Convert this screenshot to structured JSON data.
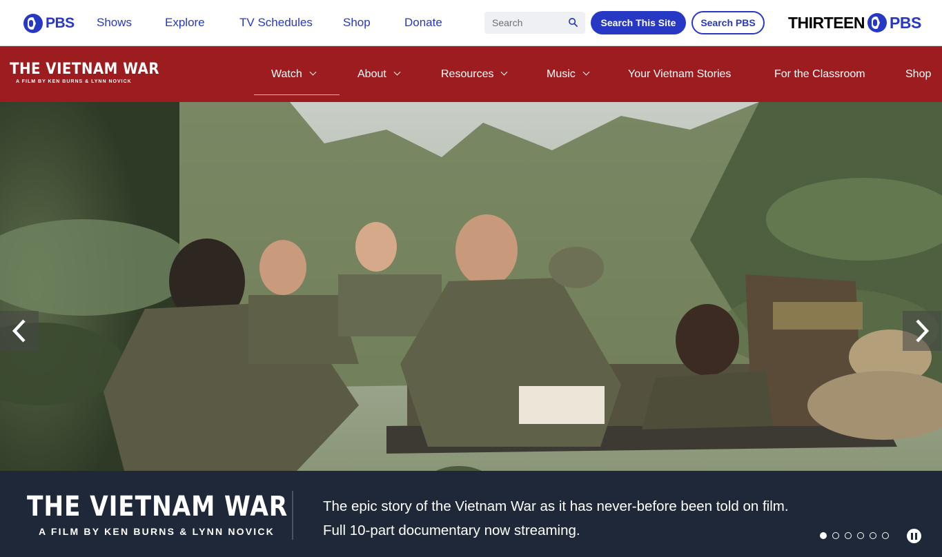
{
  "pbs_bar": {
    "logo_text": "PBS",
    "nav": [
      "Shows",
      "Explore",
      "TV Schedules",
      "Shop",
      "Donate"
    ],
    "search_placeholder": "Search",
    "search_site_label": "Search This Site",
    "search_pbs_label": "Search PBS",
    "station_name": "THIRTEEN",
    "station_pbs": "PBS",
    "brand_color": "#2638c4"
  },
  "show_bar": {
    "logo_title": "THE VIETNAM WAR",
    "logo_subtitle": "A FILM BY KEN BURNS & LYNN NOVICK",
    "nav": [
      {
        "label": "Watch",
        "dropdown": true,
        "active": true
      },
      {
        "label": "About",
        "dropdown": true
      },
      {
        "label": "Resources",
        "dropdown": true
      },
      {
        "label": "Music",
        "dropdown": true
      },
      {
        "label": "Your Vietnam Stories",
        "dropdown": false
      },
      {
        "label": "For the Classroom",
        "dropdown": false
      },
      {
        "label": "Shop",
        "dropdown": false
      }
    ],
    "background_color": "#9c1c1f"
  },
  "hero": {
    "prev_icon": "chevron-left-icon",
    "next_icon": "chevron-right-icon"
  },
  "caption": {
    "logo_title": "THE VIETNAM WAR",
    "logo_subtitle": "A FILM BY KEN BURNS & LYNN NOVICK",
    "line1": "The epic story of the Vietnam War as it has never-before been told on film.",
    "line2": "Full 10-part documentary now streaming.",
    "slide_count": 6,
    "active_slide": 1,
    "background_color": "#1f2838"
  }
}
